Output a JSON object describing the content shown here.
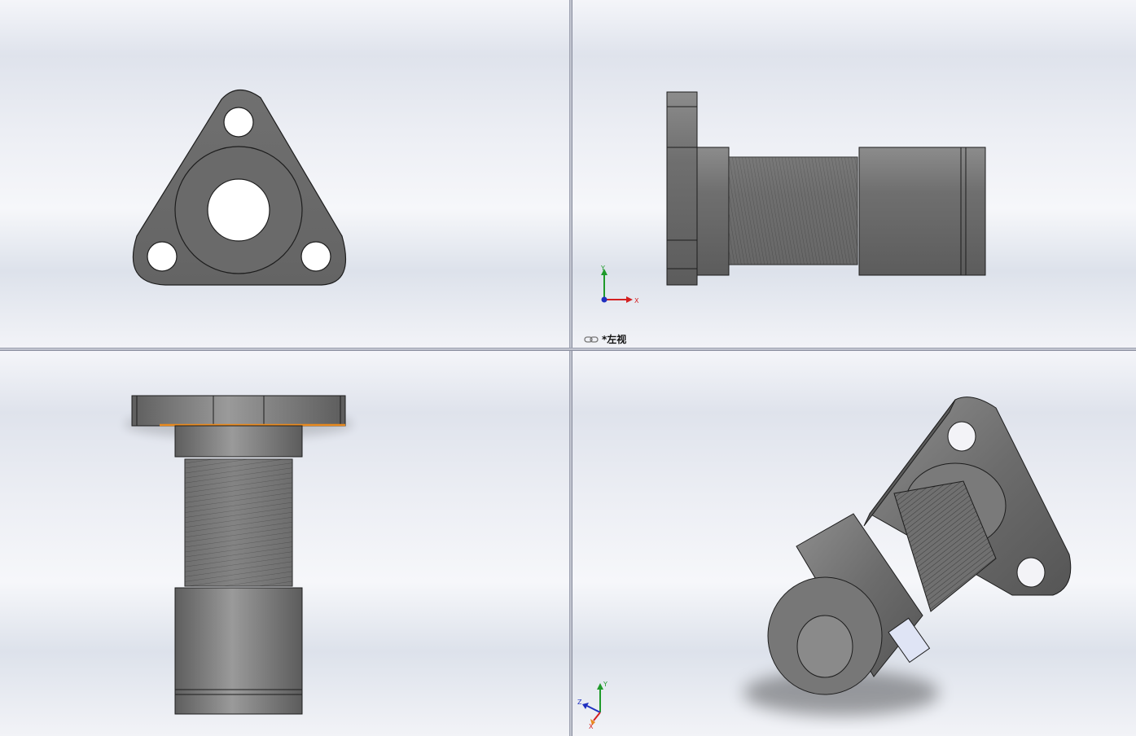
{
  "viewports": {
    "top_left": {
      "name": "front-view"
    },
    "top_right": {
      "name": "left-view",
      "label": "*左视",
      "triad_axes": [
        "Y",
        "X"
      ]
    },
    "bottom_left": {
      "name": "top-view"
    },
    "bottom_right": {
      "name": "isometric-view",
      "triad_axes": [
        "Y",
        "Z",
        "X"
      ]
    }
  },
  "colors": {
    "part_gray": "#6e6e6e",
    "edge": "#222222",
    "selection_highlight": "#e98a1e",
    "axis_x": "#d42020",
    "axis_y": "#1f9a2a",
    "axis_z": "#2030c0"
  },
  "icons": [
    "link-icon",
    "view-triad-icon"
  ]
}
